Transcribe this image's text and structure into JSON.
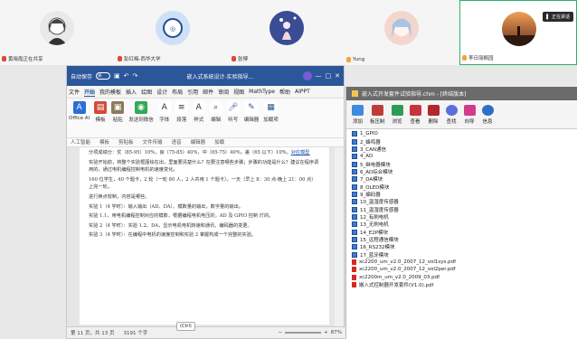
{
  "participants": [
    {
      "name": "黄晓霞正在共享",
      "mic": "red"
    },
    {
      "name": "彭红梅-西华大学",
      "mic": "red"
    },
    {
      "name": "张博",
      "mic": "red"
    },
    {
      "name": "Yung",
      "mic": "orange"
    },
    {
      "name": "李日丽枫园",
      "mic": "orange",
      "active": true
    }
  ],
  "share_badge": "正在讲话",
  "word": {
    "autosave_label": "自动保存",
    "toggle_state": "关",
    "title": "嵌入式系统设计-实验指导...",
    "menus": [
      "文件",
      "开始",
      "我的模板",
      "插入",
      "绘图",
      "设计",
      "布局",
      "引用",
      "邮件",
      "审阅",
      "视图",
      "MathType",
      "帮助",
      "AIPPT"
    ],
    "selected_menu": "开始",
    "ribbon_buttons": [
      "Office AI",
      "模板",
      "粘贴",
      "发送到微信",
      "字体",
      "段落",
      "样式",
      "编辑",
      "听写",
      "编辑器",
      "加载项"
    ],
    "ribbon_groups": [
      "人工智能",
      "模板",
      "剪贴板",
      "文件传输",
      "语音",
      "编辑器",
      "加载"
    ],
    "paragraphs": [
      "分项成绩分：优（85-95）10%，良（75-85）40%，中（65-75）40%，差（65 以下）10%。",
      "实验开始前，将整个实验框图绘在出，里面要清楚什么？在要注意哪些步骤；步骤的功能是什么？建议在程序调用的，通过电机编程控制电机的速度变化。",
      "160 位学生，40 个题卡，2 轮（一轮 80 人，2 人共用 1 个题卡）。一天（早上 8：30 点-晚上 21：00 点）上完一轮。",
      "进行换点较制，内容是哪些。",
      "实验 1（4 学时）：输入输出（AD、DA）、模数量的输出，数字量的输出。",
      "实验 1.1，用电机编程控制对应的模数，根据编程电机电压的，AD 及 GPIO 控制 灯的。",
      "实验 2（4 学时）：实验 1.2、DA，显示电机电机转速和通讯、编码器的变更。",
      "实验 3（4 学时）：在编程中电机的速度控制和实验 2 掌握构成一个完整的实验。"
    ],
    "link_text": "对应模型",
    "ctrl_tip": "(Ctrl)",
    "status_page": "第 11 页，共 13 页",
    "status_words": "3191 个字",
    "zoom": "87%"
  },
  "chm": {
    "title": "嵌入式开发套件试验指导.chm - [终结版本]",
    "tools": [
      "添加",
      "板压制",
      "浏览",
      "查看",
      "删除",
      "查找",
      "向导",
      "信息"
    ],
    "items": [
      {
        "label": "1_GPIO",
        "type": "book"
      },
      {
        "label": "2_蜂鸣器",
        "type": "book"
      },
      {
        "label": "3_CAN通信",
        "type": "book"
      },
      {
        "label": "4_AD",
        "type": "book"
      },
      {
        "label": "5_继电器模块",
        "type": "book"
      },
      {
        "label": "6_AD综合模块",
        "type": "book"
      },
      {
        "label": "7_DA模块",
        "type": "book"
      },
      {
        "label": "8_OLED模块",
        "type": "book"
      },
      {
        "label": "9_编码器",
        "type": "book"
      },
      {
        "label": "10_温湿度传感器",
        "type": "book"
      },
      {
        "label": "11_温湿度传感器",
        "type": "book"
      },
      {
        "label": "12_有刷电机",
        "type": "book"
      },
      {
        "label": "13_无刷电机",
        "type": "book"
      },
      {
        "label": "14_E2P模块",
        "type": "book"
      },
      {
        "label": "15_远程通信模块",
        "type": "book"
      },
      {
        "label": "16_RS232模块",
        "type": "book"
      },
      {
        "label": "17_蓝牙模块",
        "type": "book"
      },
      {
        "label": "xc2200_um_v2.0_2007_12_vol1sys.pdf",
        "type": "pdf"
      },
      {
        "label": "xc2200_um_v2.0_2007_12_vol2per.pdf",
        "type": "pdf"
      },
      {
        "label": "xc2200m_um_v2.0_2009_03.pdf",
        "type": "pdf"
      },
      {
        "label": "嵌入式控制器开发套件(V1.0).pdf",
        "type": "pdf"
      }
    ],
    "side_buttons": [
      "<<",
      "AI",
      "AI",
      "AI",
      "AI",
      "AI"
    ]
  }
}
